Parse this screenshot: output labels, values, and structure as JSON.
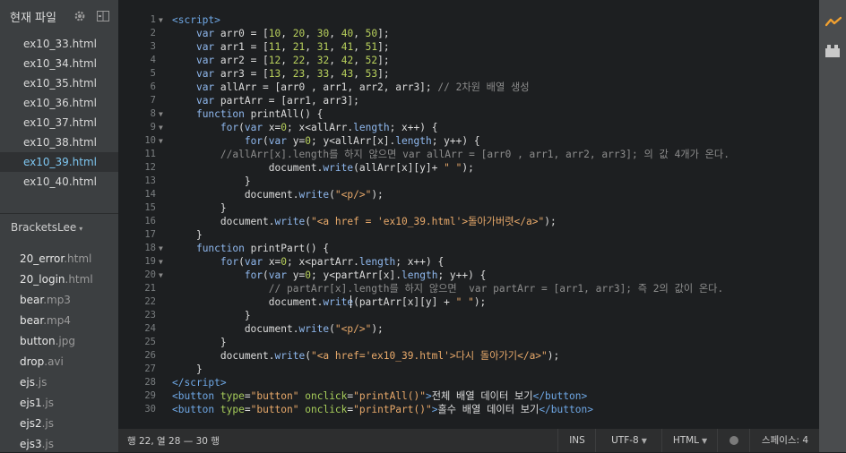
{
  "sidebar": {
    "working_files": {
      "title": "현재 파일",
      "items": [
        {
          "label": "ex10_33.html",
          "active": false
        },
        {
          "label": "ex10_34.html",
          "active": false
        },
        {
          "label": "ex10_35.html",
          "active": false
        },
        {
          "label": "ex10_36.html",
          "active": false
        },
        {
          "label": "ex10_37.html",
          "active": false
        },
        {
          "label": "ex10_38.html",
          "active": false
        },
        {
          "label": "ex10_39.html",
          "active": true
        },
        {
          "label": "ex10_40.html",
          "active": false
        }
      ]
    },
    "project": {
      "name": "BracketsLee",
      "caret": "▾",
      "files": [
        {
          "name": "20_error",
          "ext": ".html"
        },
        {
          "name": "20_login",
          "ext": ".html"
        },
        {
          "name": "bear",
          "ext": ".mp3"
        },
        {
          "name": "bear",
          "ext": ".mp4"
        },
        {
          "name": "button",
          "ext": ".jpg"
        },
        {
          "name": "drop",
          "ext": ".avi"
        },
        {
          "name": "ejs",
          "ext": ".js"
        },
        {
          "name": "ejs1",
          "ext": ".js"
        },
        {
          "name": "ejs2",
          "ext": ".js"
        },
        {
          "name": "ejs3",
          "ext": ".js"
        }
      ]
    }
  },
  "editor": {
    "lines": [
      {
        "n": "1",
        "fold": "▼",
        "html": "<span class='t'>&lt;script&gt;</span>"
      },
      {
        "n": "2",
        "fold": "",
        "html": "    <span class='k'>var</span> arr0 = [<span class='n'>10</span>, <span class='n'>20</span>, <span class='n'>30</span>, <span class='n'>40</span>, <span class='n'>50</span>];"
      },
      {
        "n": "3",
        "fold": "",
        "html": "    <span class='k'>var</span> arr1 = [<span class='n'>11</span>, <span class='n'>21</span>, <span class='n'>31</span>, <span class='n'>41</span>, <span class='n'>51</span>];"
      },
      {
        "n": "4",
        "fold": "",
        "html": "    <span class='k'>var</span> arr2 = [<span class='n'>12</span>, <span class='n'>22</span>, <span class='n'>32</span>, <span class='n'>42</span>, <span class='n'>52</span>];"
      },
      {
        "n": "5",
        "fold": "",
        "html": "    <span class='k'>var</span> arr3 = [<span class='n'>13</span>, <span class='n'>23</span>, <span class='n'>33</span>, <span class='n'>43</span>, <span class='n'>53</span>];"
      },
      {
        "n": "6",
        "fold": "",
        "html": "    <span class='k'>var</span> allArr = [arr0 , arr1, arr2, arr3]; <span class='c'>// 2차원 배열 생성</span>"
      },
      {
        "n": "7",
        "fold": "",
        "html": "    <span class='k'>var</span> partArr = [arr1, arr3];"
      },
      {
        "n": "8",
        "fold": "▼",
        "html": "    <span class='k'>function</span> printAll() {"
      },
      {
        "n": "9",
        "fold": "▼",
        "html": "        <span class='k'>for</span>(<span class='k'>var</span> x=<span class='n'>0</span>; x&lt;allArr.<span class='k'>length</span>; x++) {"
      },
      {
        "n": "10",
        "fold": "▼",
        "html": "            <span class='k'>for</span>(<span class='k'>var</span> y=<span class='n'>0</span>; y&lt;allArr[x].<span class='k'>length</span>; y++) {"
      },
      {
        "n": "11",
        "fold": "",
        "html": "        <span class='c'>//allArr[x].length를 하지 않으면 var allArr = [arr0 , arr1, arr2, arr3]; 의 값 4개가 온다.</span>"
      },
      {
        "n": "12",
        "fold": "",
        "html": "                document.<span class='k'>write</span>(allArr[x][y]+ <span class='s'>\" \"</span>);"
      },
      {
        "n": "13",
        "fold": "",
        "html": "            }"
      },
      {
        "n": "14",
        "fold": "",
        "html": "            document.<span class='k'>write</span>(<span class='s'>\"&lt;p/&gt;\"</span>);"
      },
      {
        "n": "15",
        "fold": "",
        "html": "        }"
      },
      {
        "n": "16",
        "fold": "",
        "html": "        document.<span class='k'>write</span>(<span class='s'>\"&lt;a href = 'ex10_39.html'&gt;돌아가버렷&lt;/a&gt;\"</span>);"
      },
      {
        "n": "17",
        "fold": "",
        "html": "    }"
      },
      {
        "n": "18",
        "fold": "▼",
        "html": "    <span class='k'>function</span> printPart() {"
      },
      {
        "n": "19",
        "fold": "▼",
        "html": "        <span class='k'>for</span>(<span class='k'>var</span> x=<span class='n'>0</span>; x&lt;partArr.<span class='k'>length</span>; x++) {"
      },
      {
        "n": "20",
        "fold": "▼",
        "html": "            <span class='k'>for</span>(<span class='k'>var</span> y=<span class='n'>0</span>; y&lt;partArr[x].<span class='k'>length</span>; y++) {"
      },
      {
        "n": "21",
        "fold": "",
        "html": "                <span class='c'>// partArr[x].length를 하지 않으면  var partArr = [arr1, arr3]; 즉 2의 값이 온다.</span>"
      },
      {
        "n": "22",
        "fold": "",
        "html": "                document.<span class='k'>write</span>(partArr[x][y] + <span class='s'>\" \"</span>);"
      },
      {
        "n": "23",
        "fold": "",
        "html": "            }"
      },
      {
        "n": "24",
        "fold": "",
        "html": "            document.<span class='k'>write</span>(<span class='s'>\"&lt;p/&gt;\"</span>);"
      },
      {
        "n": "25",
        "fold": "",
        "html": "        }"
      },
      {
        "n": "26",
        "fold": "",
        "html": "        document.<span class='k'>write</span>(<span class='s'>\"&lt;a href='ex10_39.html'&gt;다시 돌아가기&lt;/a&gt;\"</span>);"
      },
      {
        "n": "27",
        "fold": "",
        "html": "    }"
      },
      {
        "n": "28",
        "fold": "",
        "html": "<span class='t'>&lt;/script&gt;</span>"
      },
      {
        "n": "29",
        "fold": "",
        "html": "<span class='t'>&lt;button</span> <span class='a'>type</span>=<span class='s'>\"button\"</span> <span class='a'>onclick</span>=<span class='s'>\"printAll()\"</span><span class='t'>&gt;</span>전체 배열 데이터 보기<span class='t'>&lt;/button&gt;</span>"
      },
      {
        "n": "30",
        "fold": "",
        "html": "<span class='t'>&lt;button</span> <span class='a'>type</span>=<span class='s'>\"button\"</span> <span class='a'>onclick</span>=<span class='s'>\"printPart()\"</span><span class='t'>&gt;</span>홀수 배열 데이터 보기<span class='t'>&lt;/button&gt;</span>"
      }
    ]
  },
  "status_bar": {
    "cursor": "행 22, 열 28 — 30 행",
    "mode": "INS",
    "encoding": "UTF-8",
    "language": "HTML",
    "indent": "스페이스: 4",
    "dropdown_caret": "▼"
  },
  "icons": {
    "settings": "gear-icon",
    "split": "split-view-icon",
    "live_preview": "live-preview-icon",
    "extensions": "extension-manager-icon",
    "linter": "linter-status-icon"
  },
  "colors": {
    "accent": "#7ec6f0",
    "live_preview": "#f0a030",
    "editor_bg": "#1d1f21",
    "sidebar_bg": "#3c3f41"
  }
}
